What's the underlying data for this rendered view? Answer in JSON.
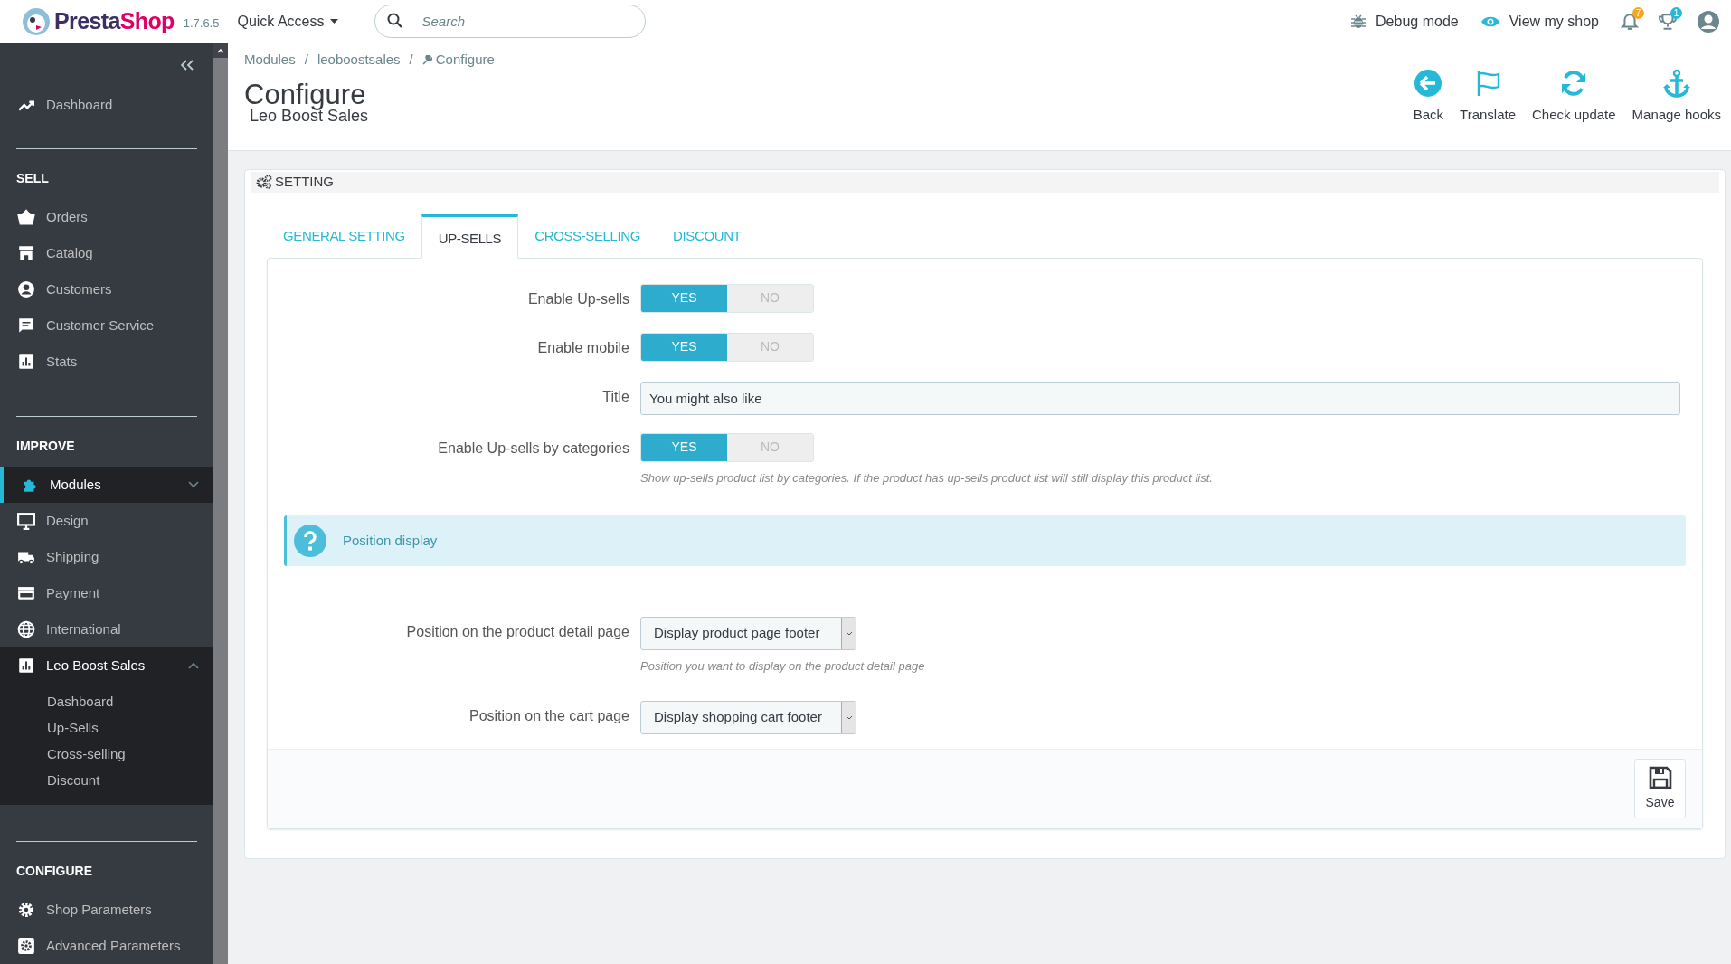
{
  "header": {
    "logo": {
      "first": "Presta",
      "second": "Shop"
    },
    "version": "1.7.6.5",
    "quick_access": "Quick Access",
    "search": {
      "placeholder": "Search"
    },
    "actions": [
      {
        "label": "Debug mode"
      },
      {
        "label": "View my shop"
      }
    ],
    "notifications": [
      {
        "count": "7",
        "color": "#f5a623"
      },
      {
        "count": "1",
        "color": "#25b9d7"
      }
    ]
  },
  "sidebar": [
    {
      "kind": "item",
      "label": "Dashboard",
      "selected": false
    },
    {
      "kind": "section",
      "label": "SELL",
      "items": [
        {
          "label": "Orders",
          "selected": false
        },
        {
          "label": "Catalog",
          "selected": false
        },
        {
          "label": "Customers",
          "selected": false
        },
        {
          "label": "Customer Service",
          "selected": false
        },
        {
          "label": "Stats",
          "selected": false
        }
      ]
    },
    {
      "kind": "section",
      "label": "IMPROVE",
      "items": [
        {
          "label": "Modules",
          "selected": true,
          "expanded": false
        },
        {
          "label": "Design",
          "selected": false
        },
        {
          "label": "Shipping",
          "selected": false
        },
        {
          "label": "Payment",
          "selected": false
        },
        {
          "label": "International",
          "selected": false
        },
        {
          "label": "Leo Boost Sales",
          "selected": false,
          "expanded": true,
          "children": [
            {
              "label": "Dashboard"
            },
            {
              "label": "Up-Sells"
            },
            {
              "label": "Cross-selling"
            },
            {
              "label": "Discount"
            }
          ]
        }
      ]
    },
    {
      "kind": "section",
      "label": "CONFIGURE",
      "items": [
        {
          "label": "Shop Parameters",
          "selected": false
        },
        {
          "label": "Advanced Parameters",
          "selected": false
        }
      ]
    }
  ],
  "breadcrumb": {
    "items": [
      "Modules",
      "leoboostsales",
      "Configure"
    ],
    "separators": [
      "/",
      "/"
    ]
  },
  "page_title": "Configure",
  "page_subtitle": "Leo Boost Sales",
  "toolbar": [
    {
      "label": "Back"
    },
    {
      "label": "Translate"
    },
    {
      "label": "Check update"
    },
    {
      "label": "Manage hooks"
    }
  ],
  "panel": {
    "heading": "SETTING",
    "tabs": [
      {
        "label": "GENERAL SETTING",
        "selected": false
      },
      {
        "label": "UP-SELLS",
        "selected": true
      },
      {
        "label": "CROSS-SELLING",
        "selected": false
      },
      {
        "label": "DISCOUNT",
        "selected": false
      }
    ],
    "fields": [
      {
        "kind": "toggle",
        "label": "Enable Up-sells",
        "yes": "YES",
        "no": "NO",
        "on": true
      },
      {
        "kind": "toggle",
        "label": "Enable mobile",
        "yes": "YES",
        "no": "NO",
        "on": true
      },
      {
        "kind": "text",
        "label": "Title",
        "value": "You might also like"
      },
      {
        "kind": "toggle",
        "label": "Enable Up-sells by categories",
        "yes": "YES",
        "no": "NO",
        "on": true,
        "help": "Show up-sells product list by categories. If the product has up-sells product list will still display this product list."
      },
      {
        "kind": "alert",
        "label": "Position display"
      },
      {
        "kind": "select",
        "label": "Position on the product detail page",
        "value": "Display product page footer",
        "help": "Position you want to display on the product detail page"
      },
      {
        "kind": "select",
        "label": "Position on the cart page",
        "value": "Display shopping cart footer"
      }
    ],
    "save": "Save"
  }
}
